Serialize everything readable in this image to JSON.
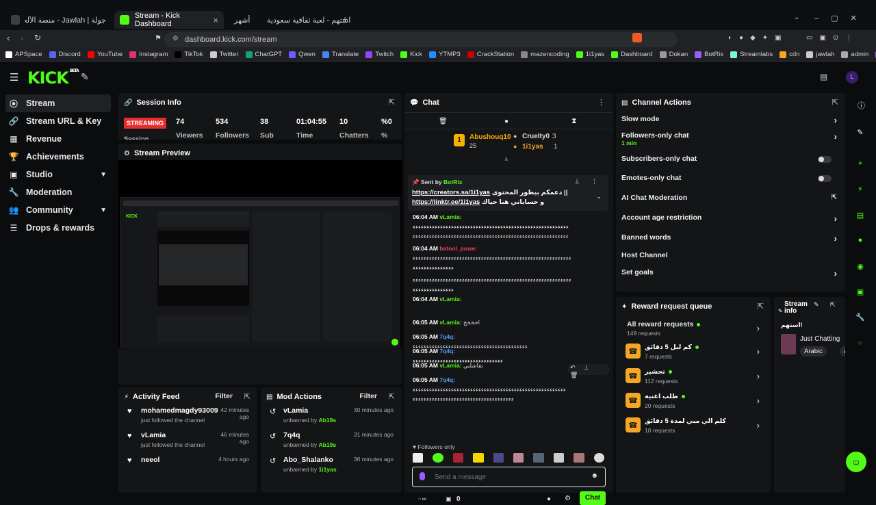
{
  "browser": {
    "tabs": [
      {
        "label": "جولة | Jawlah - منصة الألعاب التفاعلية",
        "color": "#3b3f46"
      },
      {
        "label": "Stream - Kick Dashboard",
        "color": "#53fc18"
      },
      {
        "label": "استهم - لعبة ثقافية سعودية",
        "color": "#333"
      }
    ],
    "tab_extra": "أشهر",
    "url": "dashboard.kick.com/stream",
    "bookmarks": [
      "APSpace",
      "Discord",
      "YouTube",
      "Instagram",
      "TikTok",
      "Twitter",
      "ChatGPT",
      "Qwen",
      "Translate",
      "Twitch",
      "Kick",
      "YTMP3",
      "CrackStation",
      "mazencoding",
      "1i1yas",
      "Dashboard",
      "Dokan",
      "BotRix",
      "Streamlabs",
      "cdn",
      "jawlah",
      "admin",
      "Spacemail"
    ]
  },
  "app": {
    "logo": "KICK",
    "logo_badge": "BETA",
    "sidebar": [
      {
        "label": "Stream",
        "icon": "stream-icon"
      },
      {
        "label": "Stream URL & Key",
        "icon": "link-icon"
      },
      {
        "label": "Revenue",
        "icon": "revenue-icon"
      },
      {
        "label": "Achievements",
        "icon": "trophy-icon"
      },
      {
        "label": "Studio",
        "icon": "studio-icon"
      },
      {
        "label": "Moderation",
        "icon": "wrench-icon"
      },
      {
        "label": "Community",
        "icon": "community-icon"
      },
      {
        "label": "Drops & rewards",
        "icon": "drops-icon"
      }
    ],
    "session": {
      "title": "Session Info",
      "status": "STREAMING",
      "status_sub": "Session",
      "stats": [
        {
          "value": "74",
          "label": "Viewers"
        },
        {
          "value": "534",
          "label": "Followers"
        },
        {
          "value": "38",
          "label": "Sub"
        },
        {
          "value": "01:04:55",
          "label": "Time"
        },
        {
          "value": "10",
          "label": "Chatters"
        },
        {
          "value": "%0",
          "label": "%"
        }
      ]
    },
    "preview": {
      "title": "Stream Preview"
    },
    "activity": {
      "title": "Activity Feed",
      "filter": "Filter",
      "items": [
        {
          "name": "mohamedmagdy93009",
          "sub": "just followed the channel",
          "time": "42 minutes ago"
        },
        {
          "name": "vLamia",
          "sub": "just followed the channel",
          "time": "46 minutes ago"
        },
        {
          "name": "neeol",
          "sub": "",
          "time": "4 hours ago"
        }
      ]
    },
    "mod": {
      "title": "Mod Actions",
      "filter": "Filter",
      "items": [
        {
          "name": "vLamia",
          "sub": "unbanned by",
          "by": "Ab19s",
          "time": "30 minutes ago"
        },
        {
          "name": "7q4q",
          "sub": "unbanned by",
          "by": "Ab19s",
          "time": "31 minutes ago"
        },
        {
          "name": "Abo_Shalanko",
          "sub": "unbanned by",
          "by": "1i1yas",
          "time": "36 minutes ago"
        }
      ]
    },
    "chat": {
      "title": "Chat",
      "leaders": [
        {
          "rank": "1",
          "name": "Abushouq10",
          "score": "25"
        },
        {
          "name": "Cruelty0",
          "score": "3"
        },
        {
          "name": "1i1yas",
          "score": "1"
        }
      ],
      "pinned": {
        "sent_by": "Sent by",
        "bot": "BotRix",
        "line1_link": "https://creators.sa/1i1yas",
        "line1_text": "دعمكم بيطور المحتوى",
        "line2_link": "https://linktr.ee/1i1yas",
        "line2_text": "و حساباتي هنا حياك"
      },
      "messages": [
        {
          "time": "06:04 AM",
          "user": "vLamia:",
          "color": "#53fc18",
          "text": "ءءءءءءءءءءءءءءءءءءءءءءءءءءءءءءءءءءءءءءءءءءءءءءءءءءءءءءءءء",
          "text2": "ءءءءءءءءءءءءءءءءءءءءءءءءءءءءءءءءءءءءءءءءءءءءءءءءءءءءءءءءء"
        },
        {
          "time": "06:04 AM",
          "user": "batool_powe:",
          "color": "#e2445c",
          "text": "ءءءءءءءءءءءءءءءءءءءءءءءءءءءءءءءءءءءءءءءءءءءءءءءءءءءءءءءءءء",
          "text2": "ءءءءءءءءءءءءءءء"
        },
        {
          "time": "",
          "user": "",
          "color": "#fff",
          "text": "ءءءءءءءءءءءءءءءءءءءءءءءءءءءءءءءءءءءءءءءءءءءءءءءءءءءءءءءءءء",
          "text2": "ءءءءءءءءءءءءءءء"
        },
        {
          "time": "06:04 AM",
          "user": "vLamia:",
          "color": "#53fc18",
          "text": "",
          "text2": ""
        },
        {
          "time": "06:05 AM",
          "user": "vLamia:",
          "color": "#53fc18",
          "text": "اخخخخ",
          "text2": ""
        },
        {
          "time": "06:05 AM",
          "user": "7q4q:",
          "color": "#4aa3ff",
          "text": "ءءءءءءءءءءءءءءءءءءءءءءءءءءءءءءءءءءءءءءءءءء",
          "text2": ""
        },
        {
          "time": "06:05 AM",
          "user": "7q4q:",
          "color": "#4aa3ff",
          "text": "ءءءءءءءءءءءءءءءءءءءءءءءءءءءءءءءءء",
          "text2": ""
        },
        {
          "time": "06:05 AM",
          "user": "vLamia:",
          "color": "#53fc18",
          "text": "تفاشلني",
          "text2": ""
        },
        {
          "time": "06:05 AM",
          "user": "7q4q:",
          "color": "#4aa3ff",
          "text": "ءءءءءءءءءءءءءءءءءءءءءءءءءءءءءءءءءءءءءءءءءءءءءءءءءءءءءءءء",
          "text2": "ءءءءءءءءءءءءءءءءءءءءءءءءءءءءءءءءءءءءء"
        }
      ],
      "followers_only": "Followers only",
      "placeholder": "Send a message",
      "count": "0",
      "send": "Chat"
    },
    "channel_actions": {
      "title": "Channel Actions",
      "items": [
        {
          "label": "Slow mode",
          "type": "arrow",
          "sub": ""
        },
        {
          "label": "Followers-only chat",
          "type": "arrow",
          "sub": "1 min"
        },
        {
          "label": "Subscribers-only chat",
          "type": "toggle",
          "sub": ""
        },
        {
          "label": "Emotes-only chat",
          "type": "toggle",
          "sub": ""
        },
        {
          "label": "AI Chat Moderation",
          "type": "link",
          "sub": ""
        },
        {
          "label": "Account age restriction",
          "type": "arrow",
          "sub": ""
        },
        {
          "label": "Banned words",
          "type": "arrow",
          "sub": ""
        },
        {
          "label": "Host Channel",
          "type": "none",
          "sub": ""
        },
        {
          "label": "Set goals",
          "type": "arrow",
          "sub": ""
        }
      ]
    },
    "reward": {
      "title": "Reward request queue",
      "all_label": "All reward requests",
      "all_count": "149 requests",
      "items": [
        {
          "label": "كم ليل 5 دقائق",
          "count": "7 requests"
        },
        {
          "label": "تحشير",
          "count": "112 requests"
        },
        {
          "label": "طلب اغنية",
          "count": "20 requests"
        },
        {
          "label": "كلم الي مبي لمدة 5 دقائق",
          "count": "10 requests"
        }
      ]
    },
    "stream_info": {
      "title": "Stream info",
      "stream_title": "استهم!",
      "category": "Just Chatting",
      "tags": [
        "Arabic",
        "a"
      ]
    }
  }
}
